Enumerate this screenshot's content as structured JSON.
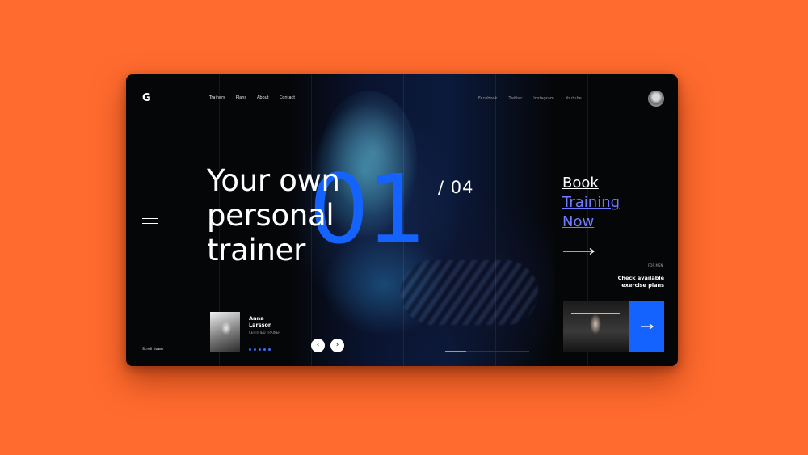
{
  "brand": {
    "logo": "G"
  },
  "nav": {
    "items": [
      "Trainers",
      "Plans",
      "About",
      "Contact"
    ]
  },
  "social": {
    "items": [
      "Facebook",
      "Twitter",
      "Instagram",
      "Youtube"
    ]
  },
  "hero": {
    "headline_lines": [
      "Your own",
      "personal",
      "trainer"
    ],
    "slide_number": "01",
    "slide_total": "/ 04",
    "scroll_label": "Scroll down"
  },
  "cta": {
    "lines": [
      "Book",
      "Training",
      "Now"
    ]
  },
  "plans": {
    "tag": "FOR MEN",
    "lines": [
      "Check available",
      "exercise plans"
    ],
    "button_icon": "arrow-right-icon"
  },
  "trainer": {
    "first_name": "Anna",
    "last_name": "Larsson",
    "role": "CERTIFIED TRAINER",
    "dots_count": 5
  },
  "slider": {
    "prev_icon": "chevron-left-icon",
    "next_icon": "chevron-right-icon",
    "progress": 0.25
  },
  "colors": {
    "accent": "#1463ff",
    "link": "#6f7cff",
    "background": "#ff6b2e",
    "frame": "#050608"
  }
}
